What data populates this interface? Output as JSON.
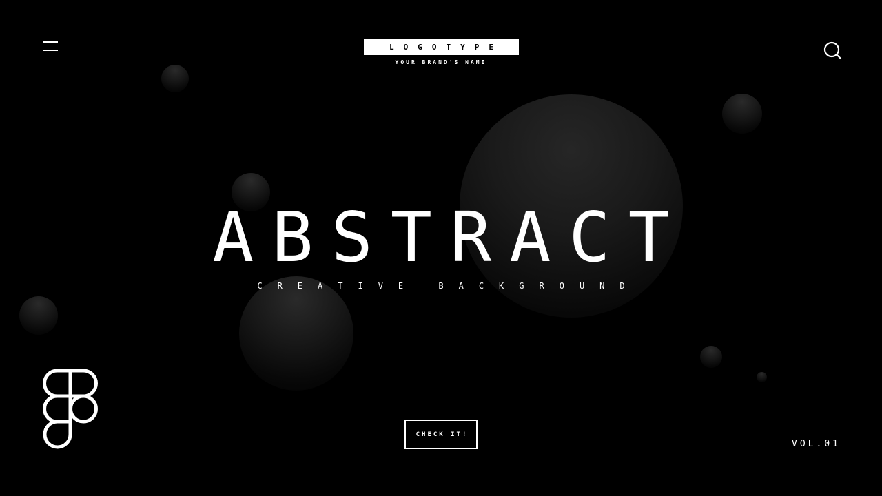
{
  "header": {
    "logotype": "LOGOTYPE",
    "brand_name": "YOUR BRAND'S NAME",
    "menu_icon": "hamburger-menu-icon",
    "search_icon": "search-icon"
  },
  "hero": {
    "title": "ABSTRACT",
    "subtitle": "CREATIVE BACKGROUND"
  },
  "cta": {
    "label": "CHECK IT!"
  },
  "footer": {
    "volume": "VOL.01",
    "figma_icon": "figma-logo-icon"
  },
  "colors": {
    "background": "#000000",
    "foreground": "#ffffff"
  }
}
